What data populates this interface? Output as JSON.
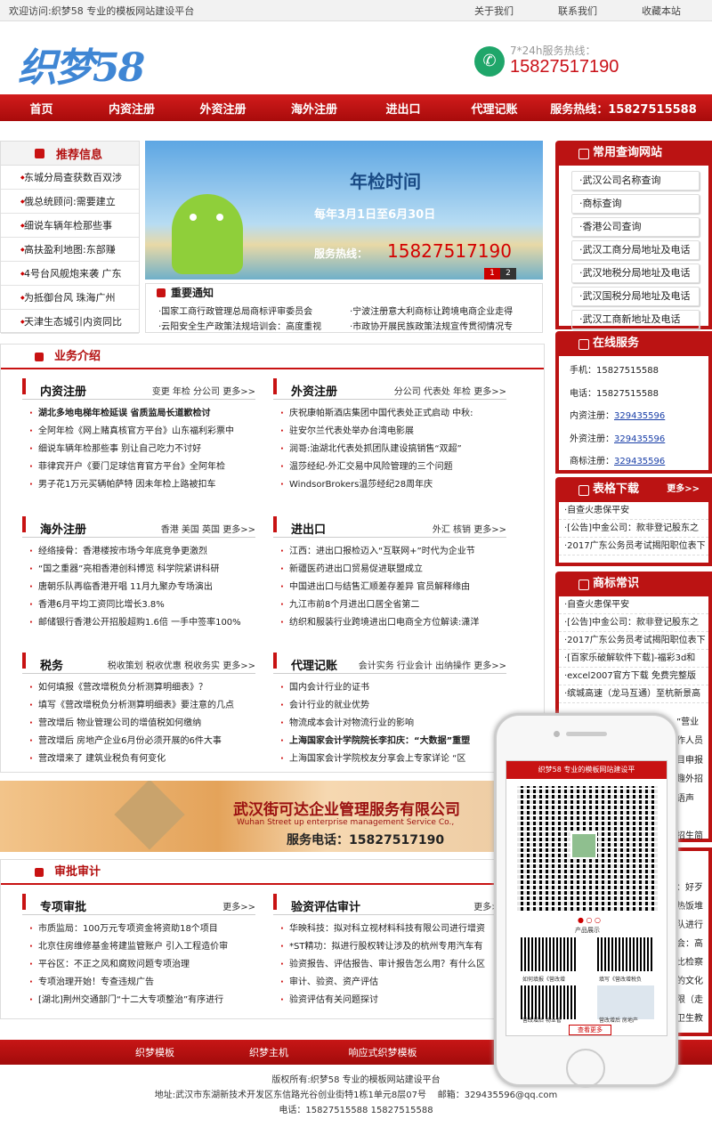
{
  "topbar": {
    "welcome": "欢迎访问:织梦58 专业的模板网站建设平台",
    "about": "关于我们",
    "contact": "联系我们",
    "fav": "收藏本站"
  },
  "logo": "织梦58",
  "hotline": {
    "label": "7*24h服务热线：",
    "number": "15827517190"
  },
  "nav": [
    "首页",
    "内资注册",
    "外资注册",
    "海外注册",
    "进出口",
    "代理记账",
    "服务热线：15827515588"
  ],
  "recommend": {
    "title": "推荐信息",
    "items": [
      "东城分局查获数百双涉",
      "俄总统顾问:需要建立",
      "细说车辆年检那些事",
      "高扶盈利地图:东部赚",
      "4号台风舰炮来袭 广东",
      "为抵御台风 珠海广州",
      "天津生态城引内资同比"
    ]
  },
  "banner": {
    "title": "年检时间",
    "dates": "每年3月1日至6月30日",
    "phone_label": "服务热线：",
    "phone": "15827517190",
    "pages": [
      "1",
      "2"
    ]
  },
  "notice": {
    "title": "重要通知",
    "items": [
      "·国家工商行政管理总局商标评审委员会",
      "·宁波注册意大利商标让跨境电商企业走得",
      "·云阳安全生产政策法规培训会：高度重视",
      "·市政协开展民族政策法规宣传贯彻情况专"
    ]
  },
  "right": {
    "query": {
      "title": "常用查询网站",
      "items": [
        "·武汉公司名称查询",
        "·商标查询",
        "·香港公司查询",
        "·武汉工商分局地址及电话",
        "·武汉地税分局地址及电话",
        "·武汉国税分局地址及电话",
        "·武汉工商新地址及电话"
      ]
    },
    "service": {
      "title": "在线服务",
      "phone_label": "手机：",
      "phone": "15827515588",
      "tel_label": "电话：",
      "tel": "15827515588",
      "rows": [
        {
          "label": "内资注册：",
          "qq": "329435596"
        },
        {
          "label": "外资注册：",
          "qq": "329435596"
        },
        {
          "label": "商标注册：",
          "qq": "329435596"
        }
      ]
    },
    "table": {
      "title": "表格下载",
      "title_left": "载",
      "more": "更多>>",
      "items": [
        "·自查火患保平安",
        "·[公告]中金公司：款非登记股东之",
        "·2017广东公务员考试揭阳职位表下"
      ]
    },
    "trademark": {
      "title": "商标常识",
      "items": [
        "·自查火患保平安",
        "·[公告]中金公司：款非登记股东之",
        "·2017广东公务员考试揭阳职位表下",
        "·[百家乐破解软件下载]-福彩3d和",
        "·excel2007官方下载 免费完整版",
        "·缤城高速（龙马互通）至杭新景高"
      ],
      "clip": [
        "”营业",
        "作人员",
        "目申报",
        "趣外招",
        "语声",
        "招生简"
      ]
    },
    "approval_clip": [
      "：好歹",
      "热饭堆",
      "队进行",
      "会：高",
      "比检察",
      "的文化",
      "限（走",
      "卫生教"
    ]
  },
  "business": {
    "title": "业务介绍",
    "cats": [
      {
        "name": "内资注册",
        "tags": "变更  年检  分公司  更多>>",
        "items": [
          {
            "t": "湖北多地电梯年检延误 省质监局长道歉检讨",
            "b": true
          },
          {
            "t": "全阿年检《网上赌真核官方平台》山东福利彩票中"
          },
          {
            "t": "细说车辆年检那些事 别让自己吃力不讨好"
          },
          {
            "t": "菲律宾开户《要门足球信育官方平台》全阿年检"
          },
          {
            "t": "男子花1万元买辆帕萨特 因未年检上路被扣车"
          }
        ]
      },
      {
        "name": "外资注册",
        "tags": "分公司  代表处  年检  更多>>",
        "items": [
          {
            "t": "庆祝康帕斯酒店集团中国代表处正式启动 中秋:"
          },
          {
            "t": "驻安尔兰代表处举办台湾电影展"
          },
          {
            "t": "润哥:油湖北代表处抓团队建设搞销售“双超”"
          },
          {
            "t": "温莎经纪-外汇交易中风险管理的三个问题"
          },
          {
            "t": "WindsorBrokers温莎经纪28周年庆"
          }
        ]
      },
      {
        "name": "海外注册",
        "tags": "香港  美国  英国  更多>>",
        "items": [
          {
            "t": "经络接骨：香港楼按市场今年底竞争更激烈"
          },
          {
            "t": "“国之重器”亮相香港创科博览 科学院紧讲科研"
          },
          {
            "t": "唐朝乐队再临香港开唱 11月九聚办专场演出"
          },
          {
            "t": "香港6月平均工资同比增长3.8%"
          },
          {
            "t": "邮储银行香港公开招股超购1.6倍 一手中签率100%"
          }
        ]
      },
      {
        "name": "进出口",
        "tags": "外汇  核销  更多>>",
        "items": [
          {
            "t": "江西：进出口报检迈入“互联网+”时代为企业节"
          },
          {
            "t": "新疆医药进出口贸易促进联盟成立"
          },
          {
            "t": "中国进出口与结售汇顺差存差异 官员解释缘由"
          },
          {
            "t": "九江市前8个月进出口居全省第二"
          },
          {
            "t": "纺织和服装行业跨境进出口电商全方位解读:潇洋"
          }
        ]
      },
      {
        "name": "税务",
        "tags": "税收策划  税收优惠  税收务实  更多>>",
        "items": [
          {
            "t": "如何填报《营改增税负分析测算明细表》？"
          },
          {
            "t": "填写《营改增税负分析测算明细表》要注意的几点"
          },
          {
            "t": "营改增后 物业管理公司的增值税如何缴纳"
          },
          {
            "t": "营改增后 房地产企业6月份必须开展的6件大事"
          },
          {
            "t": "营改增来了 建筑业税负有何变化"
          }
        ]
      },
      {
        "name": "代理记账",
        "tags": "会计实务  行业会计  出纳操作  更多>>",
        "items": [
          {
            "t": "国内会计行业的证书"
          },
          {
            "t": "会计行业的就业优势"
          },
          {
            "t": "物流成本会计对物流行业的影响"
          },
          {
            "t": "上海国家会计学院院长李扣庆：“大数据”重塑",
            "b": true
          },
          {
            "t": "上海国家会计学院校友分享会上专家详论 “区"
          }
        ]
      }
    ]
  },
  "ad": {
    "company": "武汉街可达企业管理服务有限公司",
    "en": "Wuhan Street up enterprise management Service Co.,",
    "phone": "服务电话：15827517190"
  },
  "approval": {
    "title": "审批审计",
    "cats": [
      {
        "name": "专项审批",
        "tags": "更多>>",
        "items": [
          {
            "t": "市质监局：100万元专项资金将资助18个项目"
          },
          {
            "t": "北京住房维修基金将建监管账户 引入工程造价审"
          },
          {
            "t": "平谷区：不正之风和腐败问题专项治理"
          },
          {
            "t": "专项治理开始！专查违规广告"
          },
          {
            "t": "[湖北]荆州交通部门“十二大专项整治”有序进行"
          }
        ]
      },
      {
        "name": "验资评估审计",
        "tags": "更多>>",
        "items": [
          {
            "t": "华映科技：拟对科立视材料科技有限公司进行增资"
          },
          {
            "t": "*ST精功：拟进行股权转让涉及的杭州专用汽车有"
          },
          {
            "t": "验资报告、评估报告、审计报告怎么用？有什么区"
          },
          {
            "t": "审计、验资、资产评估"
          },
          {
            "t": "验资评估有关问题探讨"
          }
        ]
      }
    ]
  },
  "phone_popup": {
    "header": "织梦58 专业的模板网站建设平",
    "section": "产品展示",
    "caps": [
      "如何填报《营改增",
      "填写《营改增税负",
      "营改增后 物业管",
      "营改增后 房地产"
    ],
    "more": "查看更多"
  },
  "footer": {
    "links": [
      "织梦模板",
      "织梦主机",
      "响应式织梦模板",
      "",
      ""
    ],
    "copyright": "版权所有:织梦58 专业的模板网站建设平台",
    "address": "地址:武汉市东湖新技术开发区东信路光谷创业街特1栋1单元8层07号",
    "email": "邮箱：329435596@qq.com",
    "tel": "电话：15827515588  15827515588"
  },
  "colors": {
    "brand_red": "#c81212",
    "logo_blue": "#3f86d4",
    "link_blue": "#1a3fa8"
  }
}
